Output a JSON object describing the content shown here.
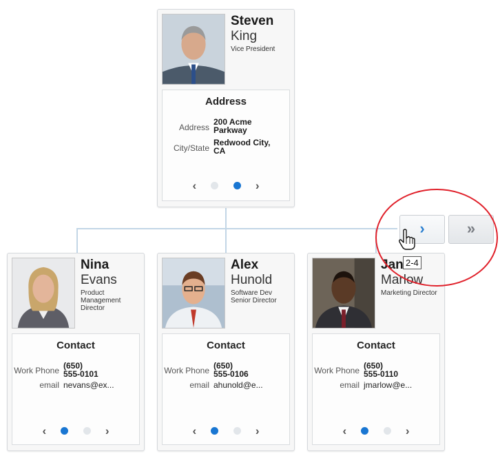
{
  "root": {
    "first": "Steven",
    "last": "King",
    "title": "Vice President",
    "section_title": "Address",
    "fields": [
      {
        "label": "Address",
        "value": "200 Acme Parkway"
      },
      {
        "label": "City/State",
        "value": "Redwood City, CA"
      }
    ]
  },
  "children": [
    {
      "first": "Nina",
      "last": "Evans",
      "title": "Product Management Director",
      "section_title": "Contact",
      "fields": [
        {
          "label": "Work Phone",
          "value": "(650) 555-0101"
        },
        {
          "label": "email",
          "value": "nevans@ex..."
        }
      ]
    },
    {
      "first": "Alex",
      "last": "Hunold",
      "title": "Software Dev Senior Director",
      "section_title": "Contact",
      "fields": [
        {
          "label": "Work Phone",
          "value": "(650) 555-0106"
        },
        {
          "label": "email",
          "value": "ahunold@e..."
        }
      ]
    },
    {
      "first": "Jan",
      "last": "Marlow",
      "title": "Marketing Director",
      "section_title": "Contact",
      "fields": [
        {
          "label": "Work Phone",
          "value": "(650) 555-0110"
        },
        {
          "label": "email",
          "value": "jmarlow@e..."
        }
      ]
    }
  ],
  "pager": {
    "prev": "‹",
    "next": "›"
  },
  "nav": {
    "next_label": "›",
    "last_label": "»",
    "tooltip": "2-4"
  },
  "colors": {
    "accent": "#1976d2",
    "connector": "#c2d6e6",
    "highlight_circle": "#e0202a"
  },
  "icons": [
    "chevron-left-icon",
    "chevron-right-icon",
    "double-chevron-right-icon",
    "hand-cursor-icon"
  ]
}
